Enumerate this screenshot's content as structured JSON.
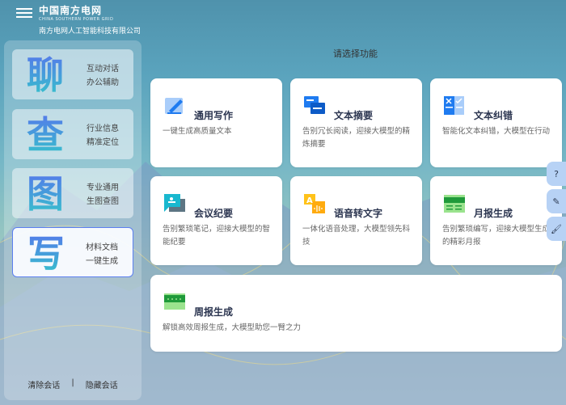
{
  "header": {
    "brand": "中国南方电网",
    "brand_en": "CHINA SOUTHERN POWER GRID",
    "company": "南方电网人工智能科技有限公司"
  },
  "sidebar": {
    "items": [
      {
        "glyph": "聊",
        "line1": "互动对话",
        "line2": "办公辅助"
      },
      {
        "glyph": "查",
        "line1": "行业信息",
        "line2": "精准定位"
      },
      {
        "glyph": "图",
        "line1": "专业通用",
        "line2": "生图查图"
      },
      {
        "glyph": "写",
        "line1": "材料文档",
        "line2": "一键生成"
      }
    ],
    "clear": "清除会话",
    "separator": "|",
    "hide": "隐藏会话"
  },
  "main": {
    "title": "请选择功能",
    "cards": [
      {
        "title": "通用写作",
        "desc": "一键生成高质量文本",
        "icon": "pen-icon"
      },
      {
        "title": "文本摘要",
        "desc": "告别冗长阅读，迎接大模型的精炼摘要",
        "icon": "summary-icon"
      },
      {
        "title": "文本纠错",
        "desc": "智能化文本纠错，大模型在行动",
        "icon": "checklist-icon"
      },
      {
        "title": "会议纪要",
        "desc": "告别繁琐笔记，迎接大模型的智能纪要",
        "icon": "meeting-icon"
      },
      {
        "title": "语音转文字",
        "desc": "一体化语音处理，大模型领先科技",
        "icon": "speech-icon"
      },
      {
        "title": "月报生成",
        "desc": "告别繁琐编写，迎接大模型生成的精彩月报",
        "icon": "monthly-report-icon"
      },
      {
        "title": "周报生成",
        "desc": "解锁高效周报生成，大模型助您一臂之力",
        "icon": "weekly-report-icon"
      }
    ]
  },
  "float": {
    "help": "?",
    "edit": "✎",
    "brush": "🖌"
  }
}
